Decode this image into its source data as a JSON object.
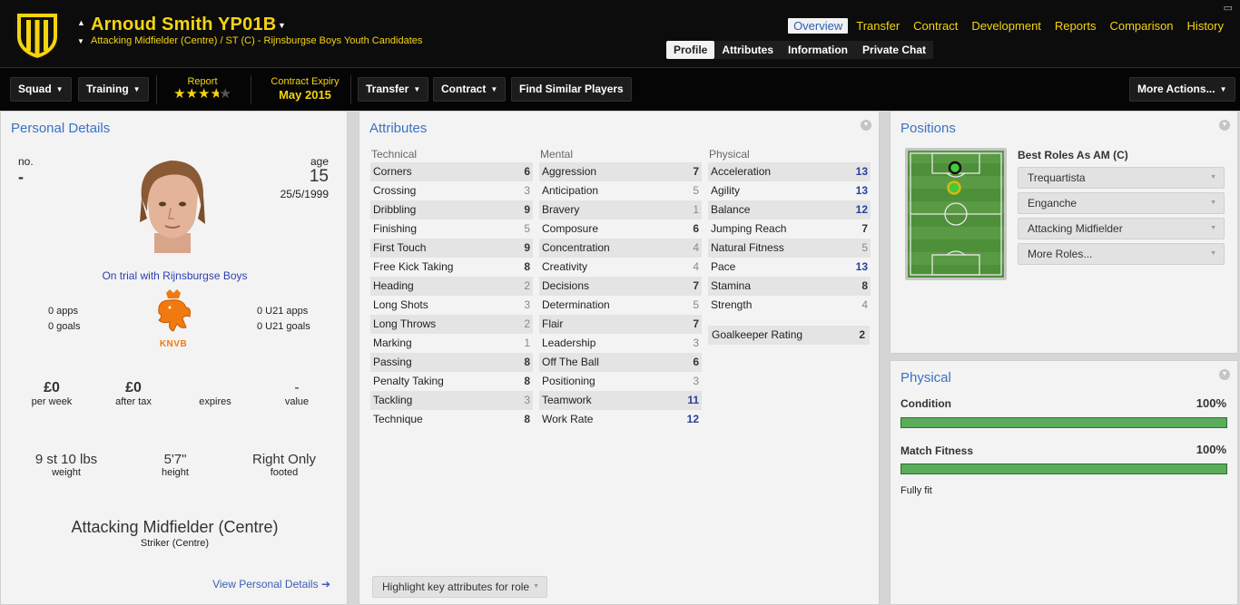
{
  "header": {
    "player_name": "Arnoud Smith YP01B",
    "subtitle": "Attacking Midfielder (Centre) / ST (C) - Rijnsburgse Boys Youth Candidates",
    "crest_icon": "club-crest-icon",
    "main_tabs": [
      "Overview",
      "Transfer",
      "Contract",
      "Development",
      "Reports",
      "Comparison",
      "History"
    ],
    "active_main_tab": "Overview",
    "sub_tabs": [
      "Profile",
      "Attributes",
      "Information",
      "Private Chat"
    ],
    "active_sub_tab": "Profile",
    "accent_color": "#f5d40f"
  },
  "toolbar": {
    "squad": "Squad",
    "training": "Training",
    "report_label": "Report",
    "report_stars": 3.5,
    "report_stars_max": 5,
    "contract_expiry_label": "Contract Expiry",
    "contract_expiry_value": "May 2015",
    "transfer": "Transfer",
    "contract": "Contract",
    "find_similar": "Find Similar Players",
    "more_actions": "More Actions..."
  },
  "personal": {
    "title": "Personal Details",
    "no_label": "no.",
    "no_value": "-",
    "age_label": "age",
    "age_value": "15",
    "dob": "25/5/1999",
    "trial_text": "On trial with Rijnsburgse Boys",
    "apps": "0 apps",
    "goals": "0 goals",
    "u21_apps": "0 U21 apps",
    "u21_goals": "0 U21 goals",
    "federation_text": "KNVB",
    "per_week_value": "£0",
    "per_week_label": "per week",
    "after_tax_value": "£0",
    "after_tax_label": "after tax",
    "expires_label": "expires",
    "value_value": "-",
    "value_label": "value",
    "weight_value": "9 st 10 lbs",
    "weight_label": "weight",
    "height_value": "5'7\"",
    "height_label": "height",
    "footed_value": "Right Only",
    "footed_label": "footed",
    "position_main": "Attacking Midfielder (Centre)",
    "position_secondary": "Striker (Centre)",
    "view_link": "View Personal Details"
  },
  "attributes": {
    "title": "Attributes",
    "technical_header": "Technical",
    "mental_header": "Mental",
    "physical_header": "Physical",
    "technical": [
      {
        "name": "Corners",
        "value": "6"
      },
      {
        "name": "Crossing",
        "value": "3"
      },
      {
        "name": "Dribbling",
        "value": "9"
      },
      {
        "name": "Finishing",
        "value": "5"
      },
      {
        "name": "First Touch",
        "value": "9"
      },
      {
        "name": "Free Kick Taking",
        "value": "8"
      },
      {
        "name": "Heading",
        "value": "2"
      },
      {
        "name": "Long Shots",
        "value": "3"
      },
      {
        "name": "Long Throws",
        "value": "2"
      },
      {
        "name": "Marking",
        "value": "1"
      },
      {
        "name": "Passing",
        "value": "8"
      },
      {
        "name": "Penalty Taking",
        "value": "8"
      },
      {
        "name": "Tackling",
        "value": "3"
      },
      {
        "name": "Technique",
        "value": "8"
      }
    ],
    "mental": [
      {
        "name": "Aggression",
        "value": "7"
      },
      {
        "name": "Anticipation",
        "value": "5"
      },
      {
        "name": "Bravery",
        "value": "1"
      },
      {
        "name": "Composure",
        "value": "6"
      },
      {
        "name": "Concentration",
        "value": "4"
      },
      {
        "name": "Creativity",
        "value": "4"
      },
      {
        "name": "Decisions",
        "value": "7"
      },
      {
        "name": "Determination",
        "value": "5"
      },
      {
        "name": "Flair",
        "value": "7"
      },
      {
        "name": "Leadership",
        "value": "3"
      },
      {
        "name": "Off The Ball",
        "value": "6"
      },
      {
        "name": "Positioning",
        "value": "3"
      },
      {
        "name": "Teamwork",
        "value": "11"
      },
      {
        "name": "Work Rate",
        "value": "12"
      }
    ],
    "physical": [
      {
        "name": "Acceleration",
        "value": "13"
      },
      {
        "name": "Agility",
        "value": "13"
      },
      {
        "name": "Balance",
        "value": "12"
      },
      {
        "name": "Jumping Reach",
        "value": "7"
      },
      {
        "name": "Natural Fitness",
        "value": "5"
      },
      {
        "name": "Pace",
        "value": "13"
      },
      {
        "name": "Stamina",
        "value": "8"
      },
      {
        "name": "Strength",
        "value": "4"
      }
    ],
    "goalkeeper_rating_label": "Goalkeeper Rating",
    "goalkeeper_rating_value": "2",
    "highlight_button": "Highlight key attributes for role"
  },
  "positions": {
    "title": "Positions",
    "best_roles_label": "Best Roles As AM (C)",
    "roles": [
      "Trequartista",
      "Enganche",
      "Attacking Midfielder",
      "More Roles..."
    ]
  },
  "physical_panel": {
    "title": "Physical",
    "condition_label": "Condition",
    "condition_value": "100%",
    "condition_fraction": 1.0,
    "fitness_label": "Match Fitness",
    "fitness_value": "100%",
    "fitness_fraction": 1.0,
    "status": "Fully fit",
    "bar_color": "#5aac5a"
  }
}
